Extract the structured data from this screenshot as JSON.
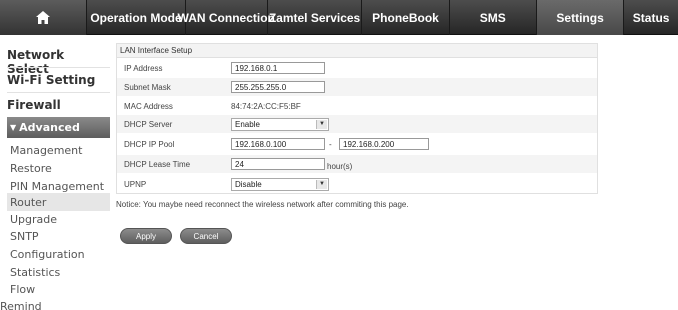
{
  "nav": {
    "home_icon": "house-icon",
    "tabs": [
      {
        "label": "Operation Mode"
      },
      {
        "label": "WAN Connection"
      },
      {
        "label": "Zamtel Services"
      },
      {
        "label": "PhoneBook"
      },
      {
        "label": "SMS"
      },
      {
        "label": "Settings",
        "active": true
      },
      {
        "label": "Status"
      }
    ]
  },
  "sidebar": {
    "main_items": [
      "Network Select",
      "Wi-Fi Setting",
      "Firewall"
    ],
    "advanced_label": "Advanced",
    "sub_items": [
      "Management",
      "Restore",
      "PIN Management",
      "Router",
      "Upgrade",
      "SNTP",
      "Configuration",
      "Statistics",
      "Flow"
    ],
    "active_sub_item": "Router",
    "remind_label": "Remind"
  },
  "lan_setup": {
    "title": "LAN Interface Setup",
    "ip_address": {
      "label": "IP Address",
      "value": "192.168.0.1"
    },
    "subnet_mask": {
      "label": "Subnet Mask",
      "value": "255.255.255.0"
    },
    "mac_address": {
      "label": "MAC Address",
      "value": "84:74:2A:CC:F5:BF"
    },
    "dhcp_server": {
      "label": "DHCP Server",
      "value": "Enable"
    },
    "dhcp_pool": {
      "label": "DHCP IP Pool",
      "start": "192.168.0.100",
      "separator": "-",
      "end": "192.168.0.200"
    },
    "lease_time": {
      "label": "DHCP Lease Time",
      "value": "24",
      "unit": "hour(s)"
    },
    "upnp": {
      "label": "UPNP",
      "value": "Disable"
    }
  },
  "notice": "Notice: You maybe need reconnect the wireless network after commiting this page.",
  "buttons": {
    "apply": "Apply",
    "cancel": "Cancel"
  },
  "colors": {
    "nav_bg": "#333333",
    "active_tab": "#5a5a5a",
    "advanced_bg": "#707070"
  }
}
